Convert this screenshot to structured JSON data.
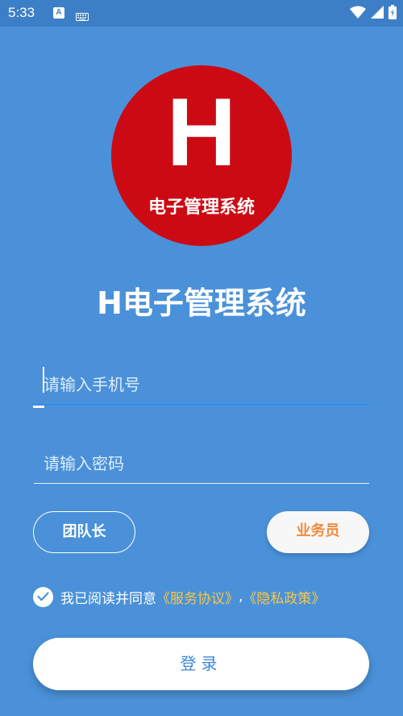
{
  "status_bar": {
    "time": "5:33",
    "icons": [
      "a-icon",
      "keyboard-icon",
      "wifi-icon",
      "signal-icon",
      "battery-icon"
    ],
    "a_glyph": "A"
  },
  "logo": {
    "letter": "H",
    "caption": "电子管理系统",
    "color": "#cc0a14"
  },
  "app_title": "H电子管理系统",
  "form": {
    "phone_placeholder": "请输入手机号",
    "password_placeholder": "请输入密码",
    "phone_value": "",
    "password_value": ""
  },
  "roles": {
    "leader_label": "团队长",
    "sales_label": "业务员",
    "selected": "业务员"
  },
  "agreement": {
    "checked": true,
    "prefix": "我已阅读并同意",
    "service_link": "《服务协议》",
    "separator": ",",
    "privacy_link": "《隐私政策》"
  },
  "login_label": "登录",
  "colors": {
    "background": "#4a91d9",
    "status_bar": "#3d7fc6",
    "link": "#f5c84c",
    "sales_text": "#f08b3e",
    "login_text": "#3f86d6",
    "focus_line": "#1e8cff"
  }
}
